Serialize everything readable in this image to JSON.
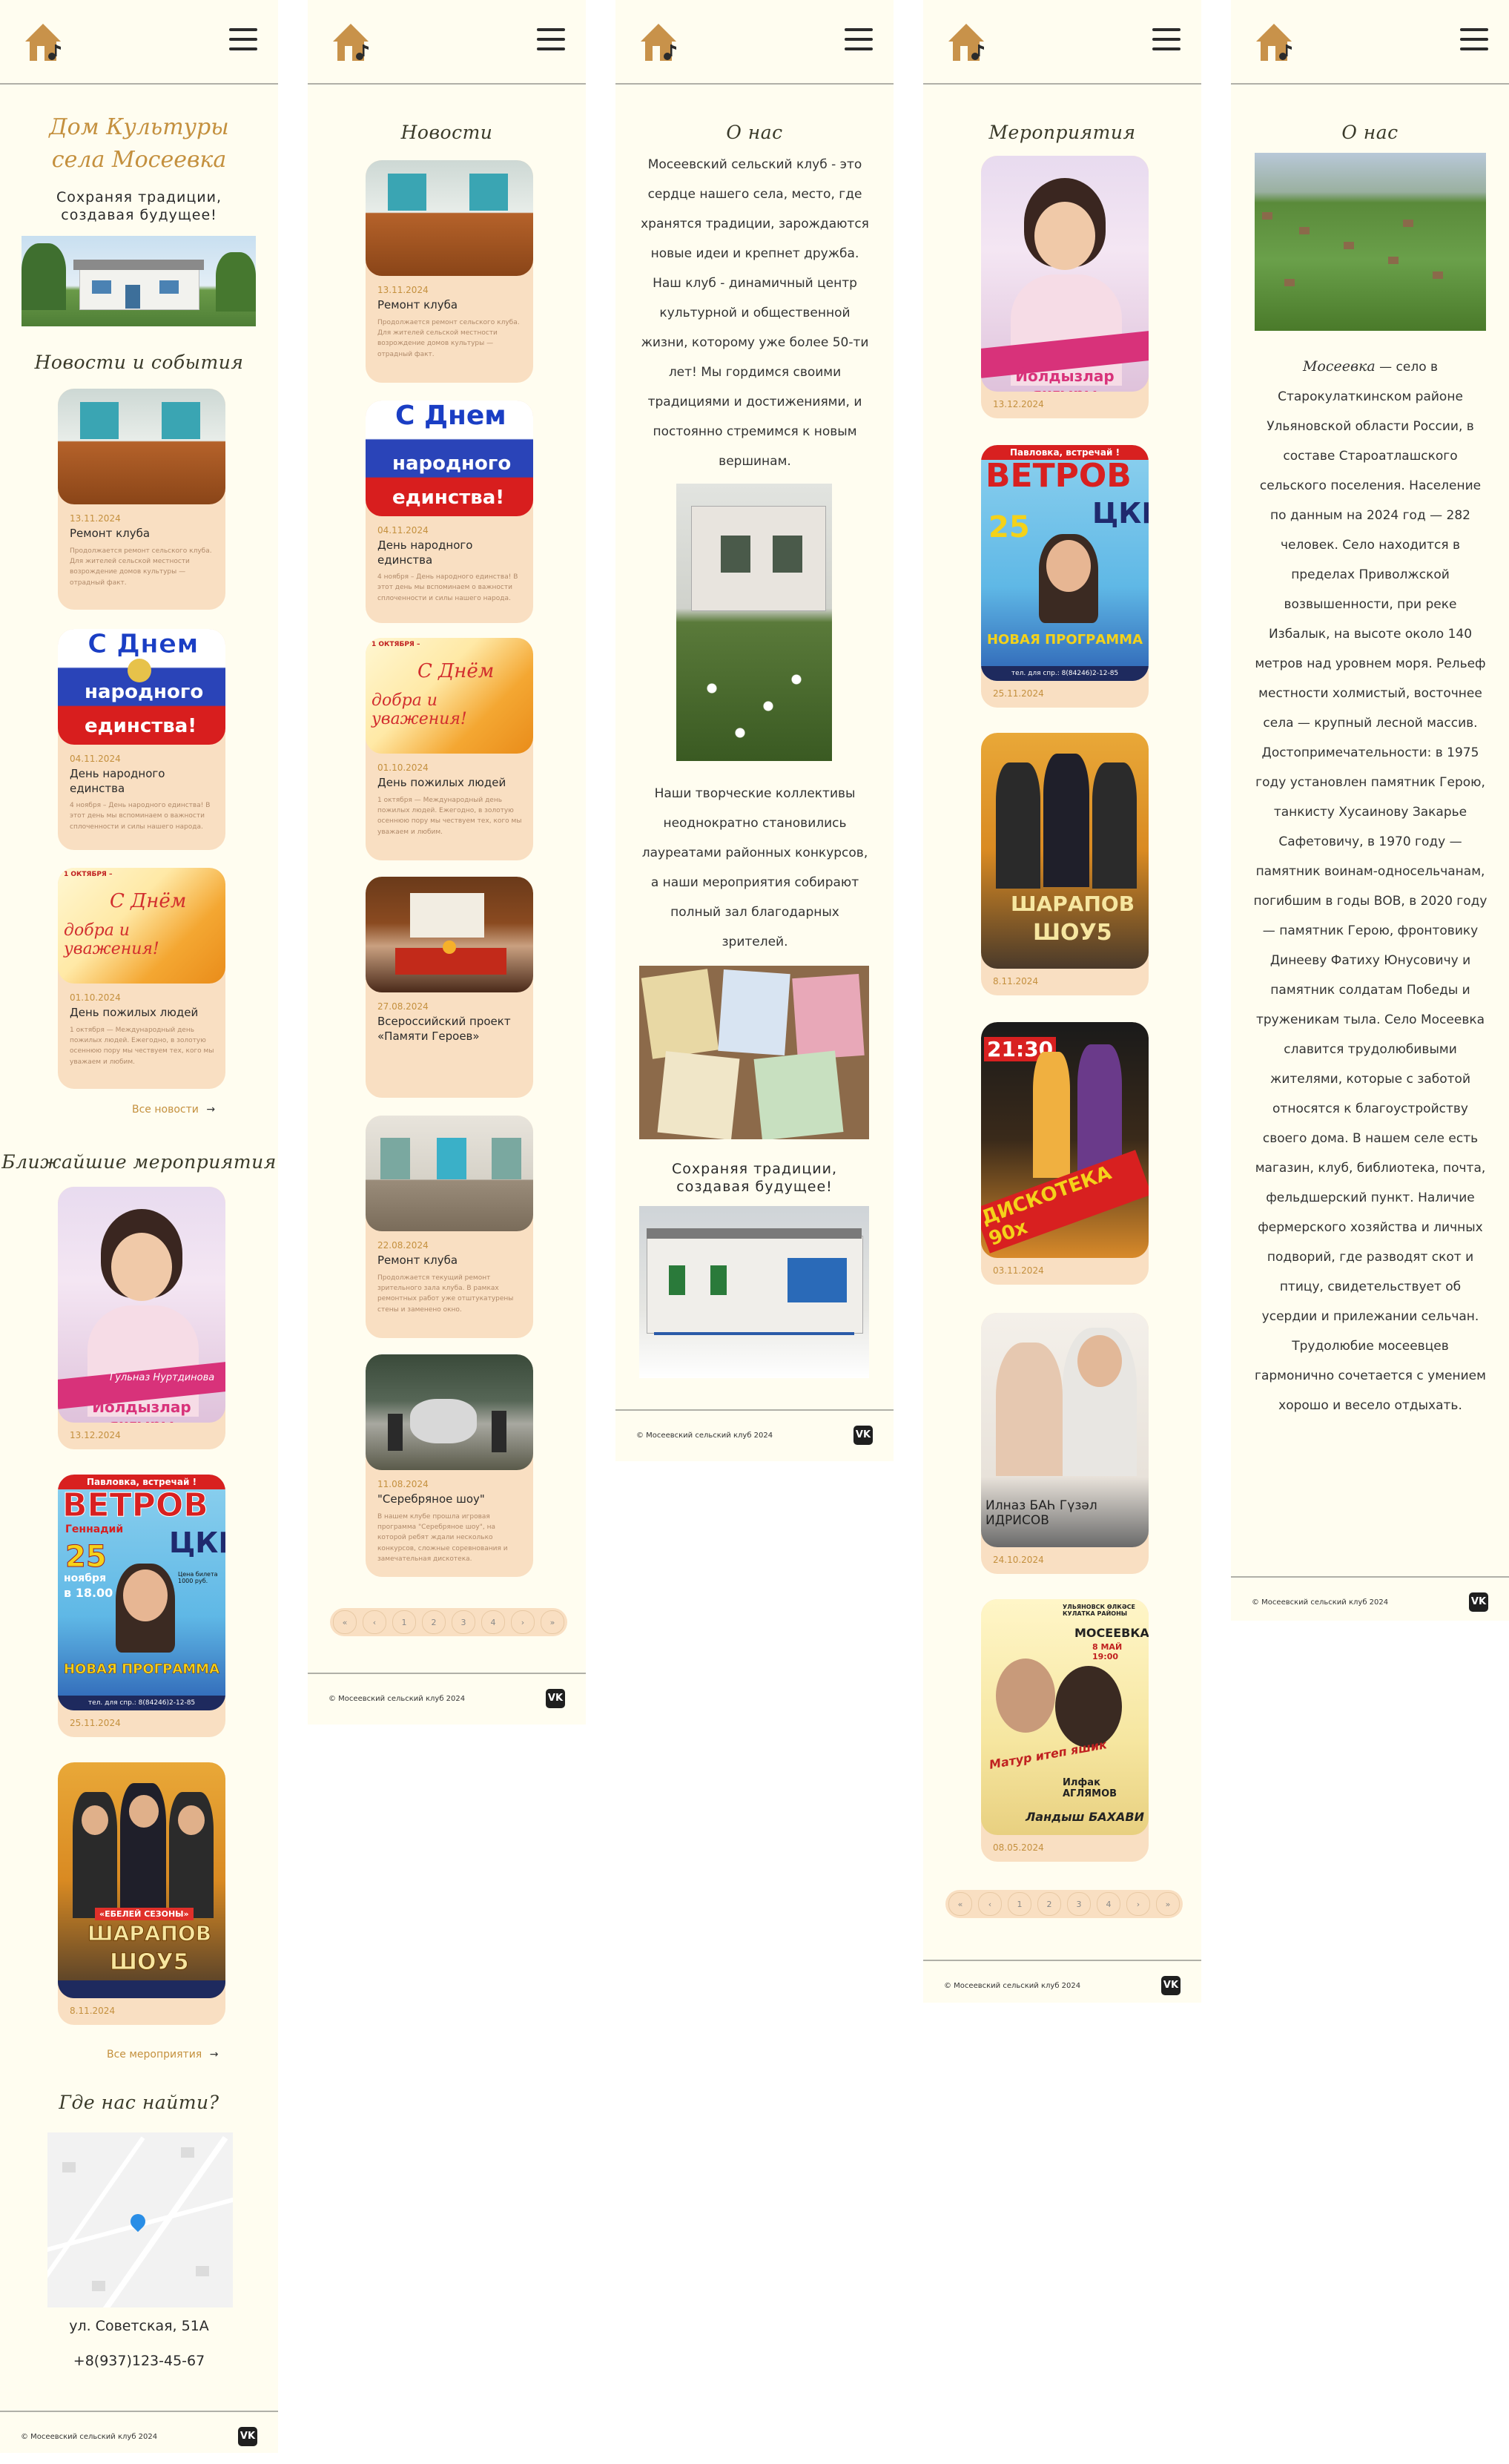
{
  "logo_icon": "house-music-note-icon",
  "menu_icon": "hamburger-menu-icon",
  "footer": {
    "copyright": "© Мосеевский сельский клуб 2024",
    "vk": "VK"
  },
  "home": {
    "hero_title_line1": "Дом Культуры",
    "hero_title_line2": "села Мосеевка",
    "hero_subtitle": "Сохраняя традиции, создавая будущее!",
    "news_section_title": "Новости и события",
    "all_news": "Все новости",
    "events_section_title": "Ближайшие мероприятия",
    "all_events": "Все мероприятия",
    "find_us_title": "Где нас найти?",
    "address": "ул. Советская, 51А",
    "phone": "+8(937)123-45-67"
  },
  "news_cards": [
    {
      "date": "13.11.2024",
      "title": "Ремонт клуба",
      "desc": "Продолжается ремонт сельского клуба. Для жителей сельской местности возрождение домов культуры — отрадный факт."
    },
    {
      "date": "04.11.2024",
      "title": "День народного единства",
      "desc": "4 ноября – День народного единства! В этот день мы вспоминаем о важности сплоченности и силы нашего народа."
    },
    {
      "date": "01.10.2024",
      "title": "День пожилых людей",
      "desc": "1 октября — Международный день пожилых людей. Ежегодно, в золотую осеннюю пору мы чествуем тех, кого мы уважаем и любим."
    },
    {
      "date": "27.08.2024",
      "title": "Всероссийский проект «Памяти Героев»",
      "desc": ""
    },
    {
      "date": "22.08.2024",
      "title": "Ремонт клуба",
      "desc": "Продолжается текущий ремонт зрительного зала клуба. В рамках ремонтных работ уже отштукатурены стены и заменено окно."
    },
    {
      "date": "11.08.2024",
      "title": "\"Серебряное шоу\"",
      "desc": "В нашем клубе прошла игровая программа \"Серебряное шоу\", на которой ребят ждали несколько конкурсов, сложные соревнования и замечательная дискотека."
    }
  ],
  "poster_texts": {
    "unity_line1": "С Днем",
    "unity_line2": "народного",
    "unity_line3": "единства!",
    "elderly_line1": "С Днём",
    "elderly_line2": "добра и уважения!",
    "elderly_top": "1 ОКТЯБРЯ –",
    "singer1_name": "Гульназ Нуртдинова",
    "singer1_sub": "Йолдызлар янгыры",
    "vetrov_top": "Павловка, встречай !",
    "vetrov_name": "ВЕТРОВ",
    "vetrov_first": "Геннадий",
    "vetrov_day": "25",
    "vetrov_month": "ноября",
    "vetrov_time": "в 18.00",
    "vetrov_venue": "ЦКР",
    "vetrov_program": "НОВАЯ ПРОГРАММА",
    "vetrov_phone": "тел. для спр.: 8(84246)2-12-85",
    "vetrov_price": "Цена билета 1000 руб.",
    "sharapov_top": "«ЕБЕЛЕЙ СЕЗОНЫ»",
    "sharapov_name": "ШАРАПОВ",
    "sharapov_show": "ШОУ5",
    "disco_time": "21:30",
    "disco_title": "ДИСКОТЕКА 90х",
    "idrisov_names": "Илназ БАҺ  Гүзәл ИДРИСОВ",
    "aglyamov_top": "УЛЬЯНОВСК ӨЛКӘСЕ КУЛАТКА РАЙОНЫ",
    "aglyamov_place": "МОСЕЕВКА",
    "aglyamov_date": "8 МАЙ 19:00",
    "aglyamov_name1": "Илфак АГЛЯМОВ",
    "aglyamov_name2": "Ландыш БАХАВИ",
    "aglyamov_show": "Матур итеп яшик"
  },
  "events": [
    {
      "date": "13.12.2024"
    },
    {
      "date": "25.11.2024"
    },
    {
      "date": "8.11.2024"
    },
    {
      "date": "03.11.2024"
    },
    {
      "date": "24.10.2024"
    },
    {
      "date": "08.05.2024"
    }
  ],
  "news_page": {
    "title": "Новости"
  },
  "events_page": {
    "title": "Мероприятия"
  },
  "pagination": [
    "«",
    "‹",
    "1",
    "2",
    "3",
    "4",
    "›",
    "»"
  ],
  "about_page": {
    "title": "О нас",
    "intro": "Мосеевский сельский клуб - это сердце нашего села, место, где хранятся традиции, зарождаются новые идеи и крепнет дружба. Наш клуб - динамичный центр культурной и общественной жизни, которому уже более 50-ти лет! Мы гордимся своими традициями и достижениями, и постоянно стремимся к новым вершинам.",
    "collectives": "Наши творческие коллективы неоднократно становились лауреатами районных конкурсов, а наши мероприятия собирают полный зал благодарных зрителей.",
    "slogan": "Сохраняя традиции, создавая будущее!"
  },
  "village_page": {
    "title": "О нас",
    "village_name": "Мосеевка",
    "text": " — село в Старокулаткинском районе Ульяновской области России, в составе Староатлашского сельского поселения. Население по данным на 2024 год — 282 человек. Село находится в пределах Приволжской возвышенности, при реке Избалык, на высоте около 140 метров над уровнем моря. Рельеф местности холмистый, восточнее села — крупный лесной массив. Достопримечательности: в 1975 году установлен памятник Герою, танкисту Хусаинову Закарье Сафетовичу, в 1970 году — памятник воинам-односельчанам, погибшим в годы ВОВ, в 2020 году — памятник Герою, фронтовику Динееву Фатиху Юнусовичу и памятник солдатам Победы и труженикам тыла. Село Мосеевка славится трудолюбивыми жителями, которые с заботой относятся к благоустройству своего дома. В нашем селе есть магазин, клуб, библиотека, почта, фельдшерский пункт. Наличие фермерского хозяйства и личных подворий, где разводят скот и птицу, свидетельствует об усердии и прилежании сельчан. Трудолюбие мосеевцев гармонично сочетается с умением хорошо и весело отдыхать."
  },
  "colors": {
    "accent": "#c4903e",
    "card_bg": "#f9dfc2",
    "page_bg": "#fffdf0"
  }
}
